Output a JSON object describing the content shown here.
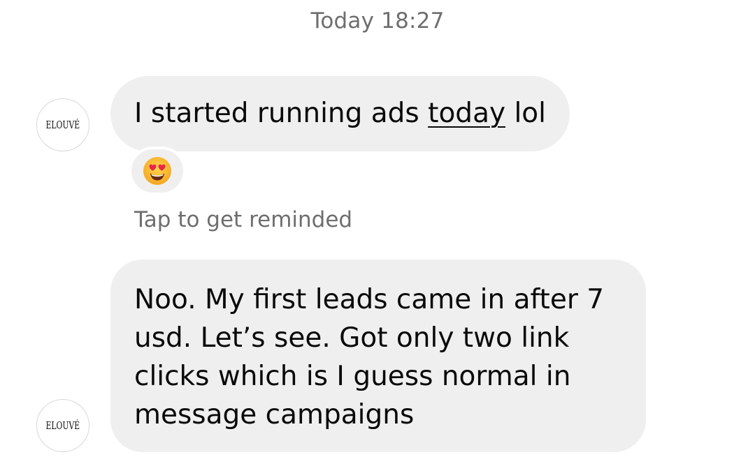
{
  "header": {
    "timestamp": "Today 18:27"
  },
  "messages": [
    {
      "sender_avatar": "ELOUVÉ",
      "text_before": "I started running ads ",
      "text_underlined": "today",
      "text_after": " lol",
      "reaction": {
        "emoji": "heart-eyes-emoji"
      },
      "reminder_text": "Tap to get reminded"
    },
    {
      "sender_avatar": "ELOUVÉ",
      "text": "Noo. My first leads came in after 7 usd. Let’s see. Got only two link clicks which is I guess normal in message campaigns"
    }
  ],
  "colors": {
    "bubble_bg": "#efefef",
    "meta_text": "#6e6e6e",
    "text": "#0a0a0a",
    "avatar_border": "#d8d8d8"
  }
}
